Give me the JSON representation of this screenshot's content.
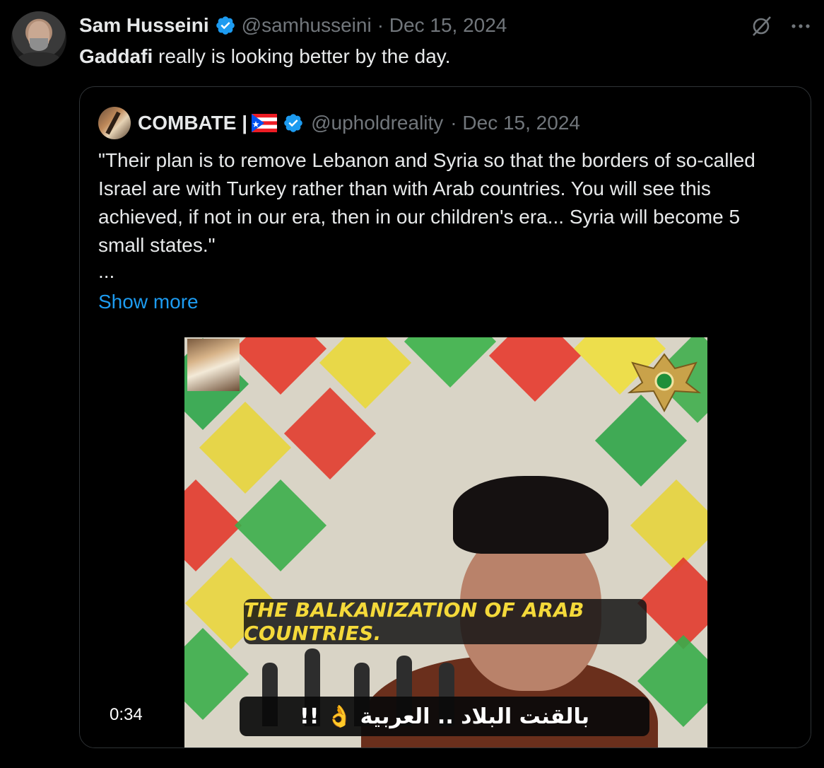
{
  "tweet": {
    "author_name": "Sam Husseini",
    "author_handle": "@samhusseini",
    "date": "· Dec 15, 2024",
    "text_bold": "Gaddafi",
    "text_rest": " really is looking better by the day."
  },
  "quoted": {
    "author_name": "COMBATE |",
    "author_handle": "@upholdreality",
    "date": "· Dec 15, 2024",
    "text": "\"Their plan is to remove Lebanon and Syria so that the borders of so-called Israel are with Turkey rather than with Arab countries. You will see this achieved, if not in our era, then in our children's era... Syria will become 5 small states.\"",
    "ellipsis": "...",
    "show_more": "Show more",
    "video": {
      "duration": "0:34",
      "subtitle_en": "THE BALKANIZATION OF ARAB COUNTRIES.",
      "subtitle_ar": "بالقنت البلاد .. العربية 👌 !!"
    }
  },
  "icons": {
    "verified": "verified-badge-icon",
    "grok": "grok-icon",
    "more": "more-icon",
    "flag": "puerto-rico-flag-icon"
  },
  "colors": {
    "background": "#000000",
    "text": "#e7e9ea",
    "muted": "#71767b",
    "link": "#1d9bf0",
    "verified": "#1d9bf0",
    "border": "#2f3336",
    "subtitle_yellow": "#f4d93a"
  }
}
